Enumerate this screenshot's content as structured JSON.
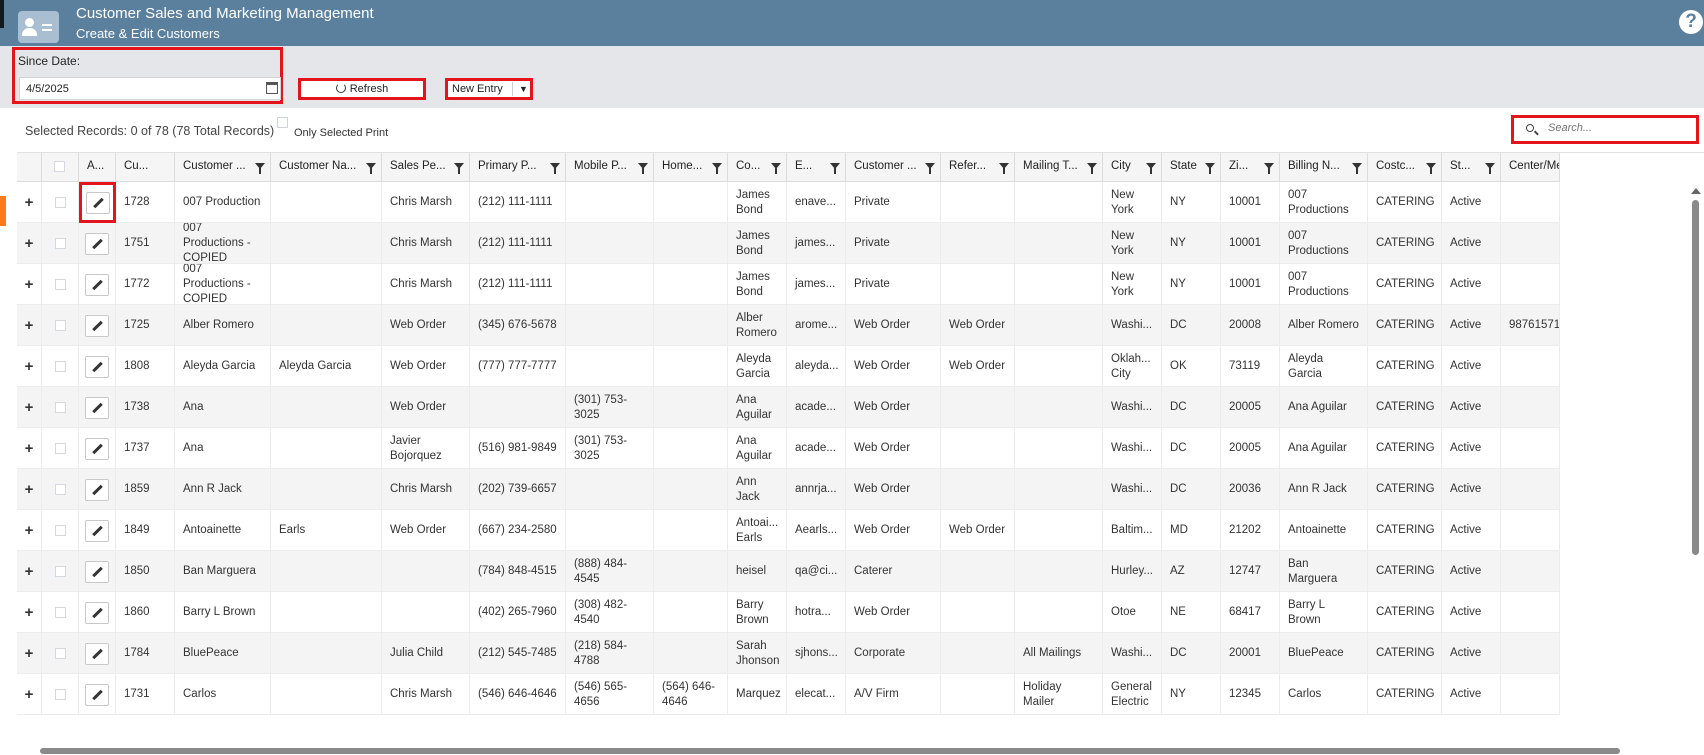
{
  "header": {
    "title": "Customer Sales and Marketing Management",
    "subtitle": "Create & Edit Customers",
    "help_icon": "?"
  },
  "toolbar": {
    "since_label": "Since Date:",
    "since_value": "4/5/2025",
    "refresh_label": "Refresh",
    "new_entry_label": "New Entry"
  },
  "selection": {
    "summary": "Selected Records: 0 of 78 (78 Total Records)",
    "only_selected_label": "Only Selected Print"
  },
  "search": {
    "placeholder": "Search..."
  },
  "columns": [
    "",
    "",
    "A...",
    "Cu...",
    "Customer ...",
    "Customer Na...",
    "Sales Pe...",
    "Primary P...",
    "Mobile P...",
    "Home...",
    "Co...",
    "E...",
    "Customer ...",
    "Refer...",
    "Mailing T...",
    "City",
    "State",
    "Zi...",
    "Billing N...",
    "Costc...",
    "St...",
    "Center/Me"
  ],
  "rows": [
    [
      "+",
      "",
      "",
      "1728",
      "007 Production",
      "",
      "Chris Marsh",
      "(212) 111-1111",
      "",
      "",
      "James Bond",
      "enave...",
      "Private",
      "",
      "",
      "New York",
      "NY",
      "10001",
      "007 Productions",
      "CATERING",
      "Active",
      ""
    ],
    [
      "+",
      "",
      "",
      "1751",
      "007 Productions - COPIED",
      "",
      "Chris Marsh",
      "(212) 111-1111",
      "",
      "",
      "James Bond",
      "james...",
      "Private",
      "",
      "",
      "New York",
      "NY",
      "10001",
      "007 Productions",
      "CATERING",
      "Active",
      ""
    ],
    [
      "+",
      "",
      "",
      "1772",
      "007 Productions - COPIED",
      "",
      "Chris Marsh",
      "(212) 111-1111",
      "",
      "",
      "James Bond",
      "james...",
      "Private",
      "",
      "",
      "New York",
      "NY",
      "10001",
      "007 Productions",
      "CATERING",
      "Active",
      ""
    ],
    [
      "+",
      "",
      "",
      "1725",
      "Alber Romero",
      "",
      "Web Order",
      "(345) 676-5678",
      "",
      "",
      "Alber Romero",
      "arome...",
      "Web Order",
      "Web Order",
      "",
      "Washi...",
      "DC",
      "20008",
      "Alber Romero",
      "CATERING",
      "Active",
      "98761571"
    ],
    [
      "+",
      "",
      "",
      "1808",
      "Aleyda Garcia",
      "Aleyda Garcia",
      "Web Order",
      "(777) 777-7777",
      "",
      "",
      "Aleyda Garcia",
      "aleyda...",
      "Web Order",
      "Web Order",
      "",
      "Oklah... City",
      "OK",
      "73119",
      "Aleyda Garcia",
      "CATERING",
      "Active",
      ""
    ],
    [
      "+",
      "",
      "",
      "1738",
      "Ana",
      "",
      "Web Order",
      "",
      "(301) 753-3025",
      "",
      "Ana Aguilar",
      "acade...",
      "Web Order",
      "",
      "",
      "Washi...",
      "DC",
      "20005",
      "Ana Aguilar",
      "CATERING",
      "Active",
      ""
    ],
    [
      "+",
      "",
      "",
      "1737",
      "Ana",
      "",
      "Javier Bojorquez",
      "(516) 981-9849",
      "(301) 753-3025",
      "",
      "Ana Aguilar",
      "acade...",
      "Web Order",
      "",
      "",
      "Washi...",
      "DC",
      "20005",
      "Ana Aguilar",
      "CATERING",
      "Active",
      ""
    ],
    [
      "+",
      "",
      "",
      "1859",
      "Ann R Jack",
      "",
      "Chris Marsh",
      "(202) 739-6657",
      "",
      "",
      "Ann Jack",
      "annrja...",
      "Web Order",
      "",
      "",
      "Washi...",
      "DC",
      "20036",
      "Ann R Jack",
      "CATERING",
      "Active",
      ""
    ],
    [
      "+",
      "",
      "",
      "1849",
      "Antoainette",
      "Earls",
      "Web Order",
      "(667) 234-2580",
      "",
      "",
      "Antoai... Earls",
      "Aearls...",
      "Web Order",
      "Web Order",
      "",
      "Baltim...",
      "MD",
      "21202",
      "Antoainette",
      "CATERING",
      "Active",
      ""
    ],
    [
      "+",
      "",
      "",
      "1850",
      "Ban Marguera",
      "",
      "",
      "(784) 848-4515",
      "(888) 484-4545",
      "",
      "heisel",
      "qa@ci...",
      "Caterer",
      "",
      "",
      "Hurley...",
      "AZ",
      "12747",
      "Ban Marguera",
      "CATERING",
      "Active",
      ""
    ],
    [
      "+",
      "",
      "",
      "1860",
      "Barry L Brown",
      "",
      "",
      "(402) 265-7960",
      "(308) 482-4540",
      "",
      "Barry Brown",
      "hotra...",
      "Web Order",
      "",
      "",
      "Otoe",
      "NE",
      "68417",
      "Barry L Brown",
      "CATERING",
      "Active",
      ""
    ],
    [
      "+",
      "",
      "",
      "1784",
      "BluePeace",
      "",
      "Julia Child",
      "(212) 545-7485",
      "(218) 584-4788",
      "",
      "Sarah Jhonson",
      "sjhons...",
      "Corporate",
      "",
      "All Mailings",
      "Washi...",
      "DC",
      "20001",
      "BluePeace",
      "CATERING",
      "Active",
      ""
    ],
    [
      "+",
      "",
      "",
      "1731",
      "Carlos",
      "",
      "Chris Marsh",
      "(546) 646-4646",
      "(546) 565-4656",
      "(564) 646-4646",
      "Marquez",
      "elecat...",
      "A/V Firm",
      "",
      "Holiday Mailer",
      "General Electric",
      "NY",
      "12345",
      "Carlos",
      "CATERING",
      "Active",
      ""
    ]
  ]
}
